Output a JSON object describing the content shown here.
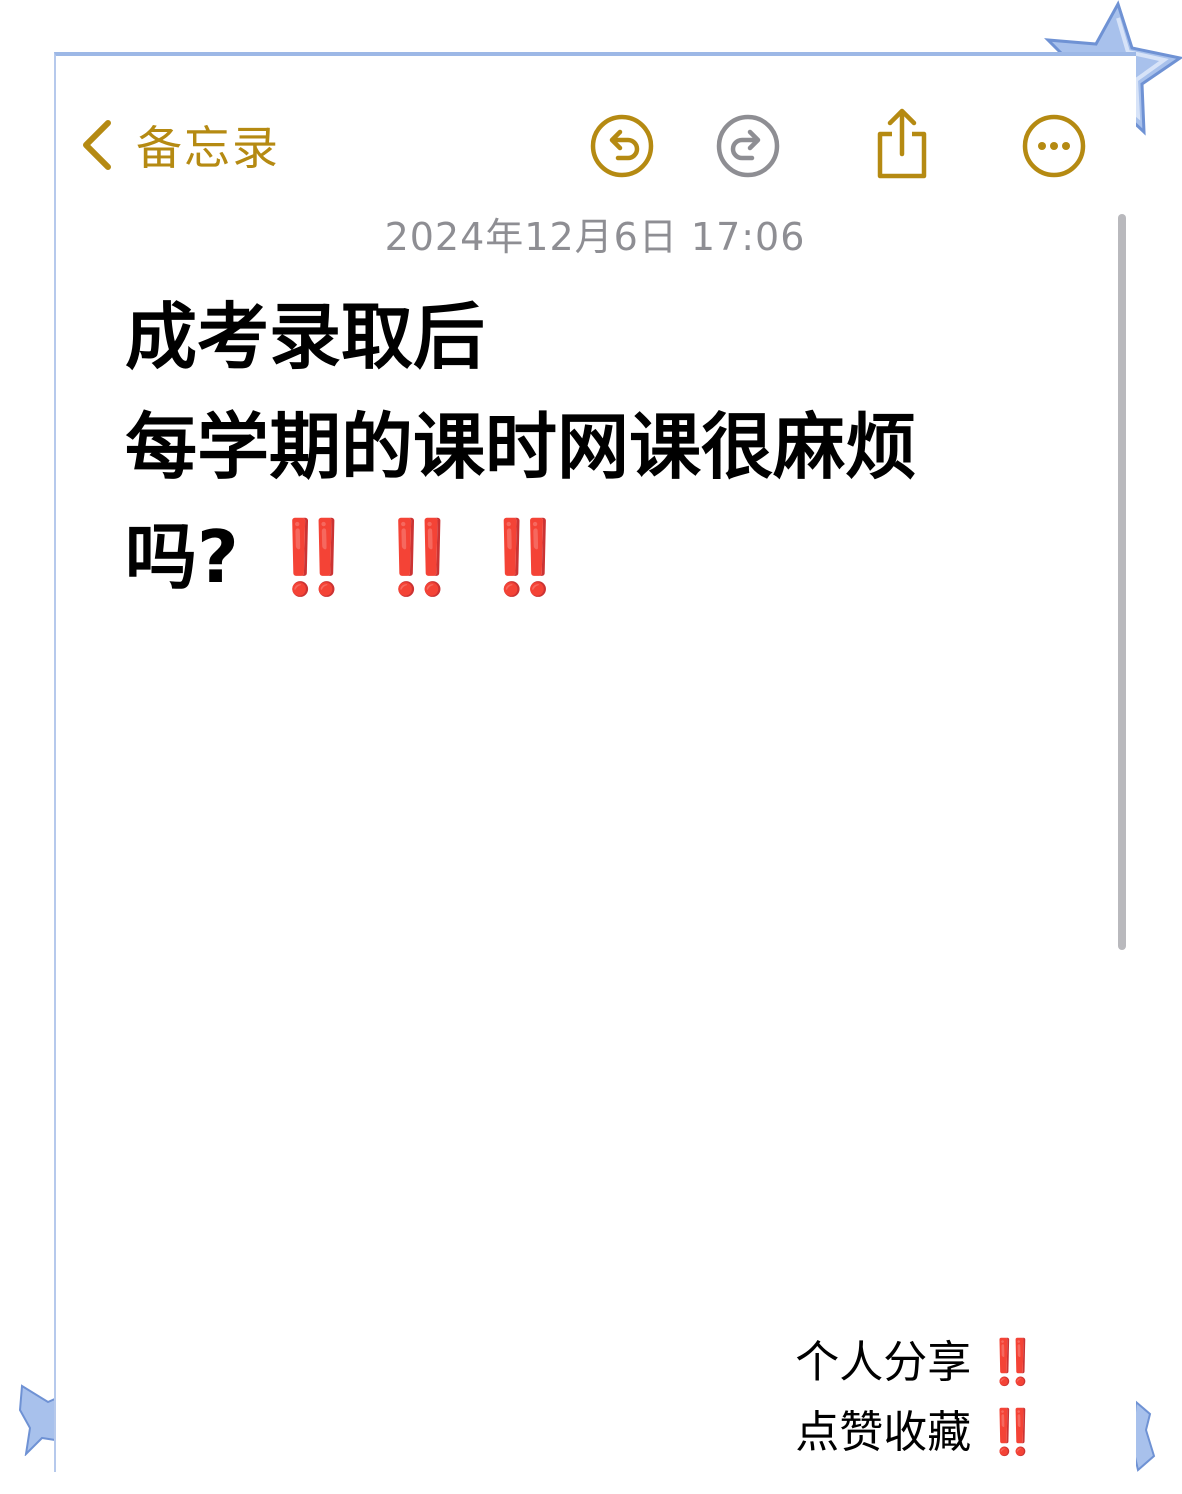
{
  "nav": {
    "back_label": "备忘录"
  },
  "toolbar": {
    "undo_icon": "undo-icon",
    "redo_icon": "redo-icon",
    "share_icon": "share-icon",
    "more_icon": "more-icon"
  },
  "note": {
    "date": "2024年12月6日 17:06",
    "title_lines": [
      "成考录取后",
      "每学期的课时网课很麻烦",
      "吗?"
    ],
    "emphasis": "‼️"
  },
  "footer": {
    "line1": "个人分享",
    "line2": "点赞收藏",
    "emphasis": "‼️"
  },
  "colors": {
    "accent": "#b58a12",
    "disabled": "#8e8e93",
    "emphasis_red": "#e41d1d",
    "frame_blue": "#9db8e6"
  }
}
